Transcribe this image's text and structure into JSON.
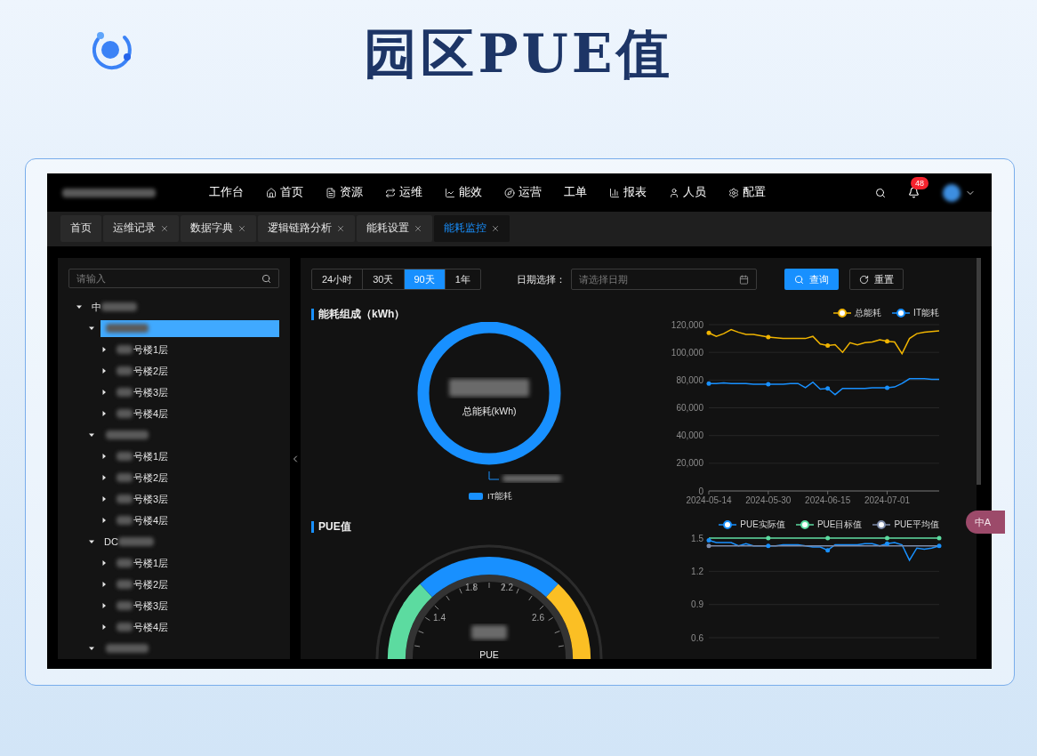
{
  "page_title": "园区PUE值",
  "nav": {
    "items": [
      {
        "label": "工作台",
        "kind": "plain"
      },
      {
        "label": "首页",
        "kind": "home"
      },
      {
        "label": "资源",
        "kind": "document"
      },
      {
        "label": "运维",
        "kind": "repeat"
      },
      {
        "label": "能效",
        "kind": "trend"
      },
      {
        "label": "运营",
        "kind": "compass"
      },
      {
        "label": "工单",
        "kind": "plain"
      },
      {
        "label": "报表",
        "kind": "bars"
      },
      {
        "label": "人员",
        "kind": "person"
      },
      {
        "label": "配置",
        "kind": "gear"
      }
    ],
    "notification_count": "48"
  },
  "tabs": [
    {
      "label": "首页",
      "closable": false,
      "selected": false
    },
    {
      "label": "运维记录",
      "closable": true,
      "selected": false
    },
    {
      "label": "数据字典",
      "closable": true,
      "selected": false
    },
    {
      "label": "逻辑链路分析",
      "closable": true,
      "selected": false
    },
    {
      "label": "能耗设置",
      "closable": true,
      "selected": false
    },
    {
      "label": "能耗监控",
      "closable": true,
      "selected": true
    }
  ],
  "tree": {
    "search_placeholder": "请输入",
    "nodes": [
      {
        "label": "中",
        "kind": "masked_suffix",
        "expanded": true,
        "selected": false,
        "children": [
          {
            "kind": "masked",
            "expanded": true,
            "selected": true,
            "children": [
              {
                "label": "号楼1层",
                "kind": "masked_prefix",
                "expanded": false,
                "selected": false
              },
              {
                "label": "号楼2层",
                "kind": "masked_prefix",
                "expanded": false,
                "selected": false
              },
              {
                "label": "号楼3层",
                "kind": "masked_prefix",
                "expanded": false,
                "selected": false
              },
              {
                "label": "号楼4层",
                "kind": "masked_prefix",
                "expanded": false,
                "selected": false
              }
            ]
          },
          {
            "kind": "masked",
            "expanded": true,
            "selected": false,
            "children": [
              {
                "label": "号楼1层",
                "kind": "masked_prefix",
                "expanded": false,
                "selected": false
              },
              {
                "label": "号楼2层",
                "kind": "masked_prefix",
                "expanded": false,
                "selected": false
              },
              {
                "label": "号楼3层",
                "kind": "masked_prefix",
                "expanded": false,
                "selected": false
              },
              {
                "label": "号楼4层",
                "kind": "masked_prefix",
                "expanded": false,
                "selected": false
              }
            ]
          },
          {
            "label": "DC",
            "kind": "masked_suffix",
            "expanded": true,
            "selected": false,
            "children": [
              {
                "label": "号楼1层",
                "kind": "masked_prefix",
                "expanded": false,
                "selected": false
              },
              {
                "label": "号楼2层",
                "kind": "masked_prefix",
                "expanded": false,
                "selected": false
              },
              {
                "label": "号楼3层",
                "kind": "masked_prefix",
                "expanded": false,
                "selected": false
              },
              {
                "label": "号楼4层",
                "kind": "masked_prefix",
                "expanded": false,
                "selected": false
              }
            ]
          },
          {
            "kind": "masked",
            "expanded": true,
            "selected": false
          }
        ]
      }
    ]
  },
  "toolbar": {
    "ranges": [
      {
        "label": "24小时",
        "selected": false
      },
      {
        "label": "30天",
        "selected": false
      },
      {
        "label": "90天",
        "selected": true
      },
      {
        "label": "1年",
        "selected": false
      }
    ],
    "date_label": "日期选择：",
    "date_placeholder": "请选择日期",
    "query_button": "查询",
    "reset_button": "重置"
  },
  "composition": {
    "title": "能耗组成（kWh）",
    "center_label": "总能耗(kWh)",
    "legend": "IT能耗"
  },
  "energy_trend": {
    "chart_data": {
      "type": "line",
      "grid": true,
      "categories": [
        "2024-05-14",
        null,
        null,
        null,
        null,
        null,
        null,
        null,
        "2024-05-30",
        null,
        null,
        null,
        null,
        null,
        null,
        null,
        "2024-06-15",
        null,
        null,
        null,
        null,
        null,
        null,
        null,
        "2024-07-01",
        null,
        null,
        null,
        null,
        null,
        null,
        null
      ],
      "ylim": [
        0,
        120000
      ],
      "yticks": [
        {
          "value": 0,
          "label": "0"
        },
        {
          "value": 20000,
          "label": "20,000"
        },
        {
          "value": 40000,
          "label": "40,000"
        },
        {
          "value": 60000,
          "label": "60,000"
        },
        {
          "value": 80000,
          "label": "80,000"
        },
        {
          "value": 100000,
          "label": "100,000"
        },
        {
          "value": 120000,
          "label": "120,000"
        }
      ],
      "series": [
        {
          "name": "总能耗",
          "color": "#f0b400",
          "values": [
            114000,
            111500,
            113500,
            116500,
            114500,
            113000,
            113000,
            112000,
            111000,
            110500,
            110000,
            110000,
            110000,
            110000,
            111500,
            106000,
            105000,
            105500,
            100000,
            107000,
            105500,
            107000,
            107500,
            109000,
            108000,
            107500,
            99000,
            110000,
            113500,
            114500,
            115000,
            115500
          ]
        },
        {
          "name": "IT能耗",
          "color": "#1890ff",
          "values": [
            77500,
            77500,
            78000,
            77500,
            77500,
            77500,
            77000,
            77000,
            77000,
            77000,
            77000,
            77500,
            77500,
            74500,
            78500,
            73500,
            74000,
            69500,
            74000,
            74000,
            74000,
            74000,
            74500,
            74500,
            74500,
            75000,
            77500,
            81000,
            81000,
            81000,
            80500,
            80500
          ]
        }
      ]
    }
  },
  "pue": {
    "title": "PUE值",
    "gauge_ticks": [
      "1.4",
      "1.8",
      "2.2",
      "2.6"
    ],
    "gauge_label": "PUE"
  },
  "pue_trend": {
    "chart_data": {
      "type": "line",
      "grid": true,
      "categories": [
        null,
        null,
        null,
        null,
        null,
        null,
        null,
        null,
        null,
        null,
        null,
        null,
        null,
        null,
        null,
        null,
        null,
        null,
        null,
        null,
        null,
        null,
        null,
        null,
        null,
        null,
        null,
        null,
        null,
        null,
        null,
        null
      ],
      "ylim": [
        0.6,
        1.5
      ],
      "yticks": [
        0.6,
        0.9,
        1.2,
        1.5
      ],
      "series": [
        {
          "name": "PUE实际值",
          "color": "#1890ff",
          "values": [
            1.48,
            1.46,
            1.46,
            1.46,
            1.43,
            1.45,
            1.43,
            1.43,
            1.43,
            1.43,
            1.44,
            1.44,
            1.44,
            1.43,
            1.42,
            1.42,
            1.39,
            1.44,
            1.44,
            1.44,
            1.44,
            1.45,
            1.45,
            1.43,
            1.45,
            1.46,
            1.44,
            1.3,
            1.41,
            1.4,
            1.41,
            1.43
          ]
        },
        {
          "name": "PUE目标值",
          "color": "#5cdba0",
          "values": [
            1.5,
            1.5,
            1.5,
            1.5,
            1.5,
            1.5,
            1.5,
            1.5,
            1.5,
            1.5,
            1.5,
            1.5,
            1.5,
            1.5,
            1.5,
            1.5,
            1.5,
            1.5,
            1.5,
            1.5,
            1.5,
            1.5,
            1.5,
            1.5,
            1.5,
            1.5,
            1.5,
            1.5,
            1.5,
            1.5,
            1.5,
            1.5
          ]
        },
        {
          "name": "PUE平均值",
          "color": "#7c8aa8",
          "values": [
            1.43,
            1.43,
            1.43,
            1.43,
            1.43,
            1.43,
            1.43,
            1.43,
            1.43,
            1.43,
            1.43,
            1.43,
            1.43,
            1.43,
            1.43,
            1.43,
            1.43,
            1.43,
            1.43,
            1.43,
            1.43,
            1.43,
            1.43,
            1.43,
            1.43,
            1.43,
            1.43,
            1.43,
            1.43,
            1.43,
            1.43,
            1.43
          ]
        }
      ]
    }
  },
  "translate_button": "中A"
}
